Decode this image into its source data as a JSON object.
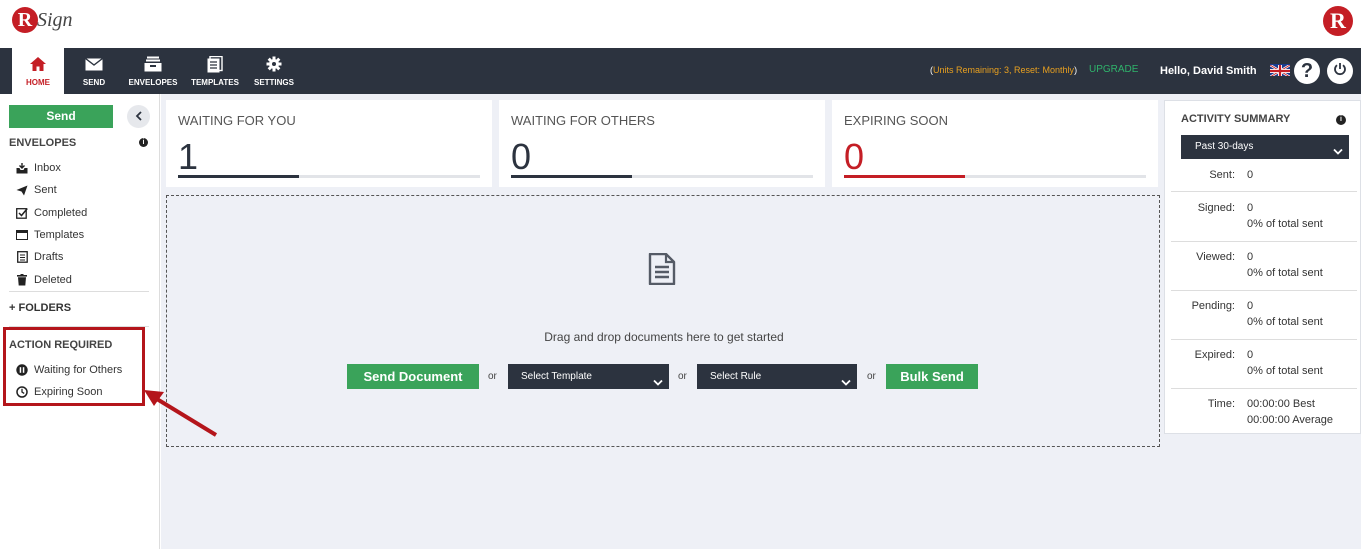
{
  "brand": {
    "initial": "R",
    "name": "Sign"
  },
  "nav": {
    "items": [
      {
        "id": "home",
        "label": "HOME"
      },
      {
        "id": "send",
        "label": "SEND"
      },
      {
        "id": "envelopes",
        "label": "ENVELOPES"
      },
      {
        "id": "templates",
        "label": "TEMPLATES"
      },
      {
        "id": "settings",
        "label": "SETTINGS"
      }
    ],
    "units_text": "Units Remaining: 3, Reset: Monthly",
    "upgrade_label": "UPGRADE",
    "greeting": "Hello, ",
    "user_name": "David Smith",
    "help_glyph": "?"
  },
  "sidebar": {
    "send_label": "Send",
    "envelopes_heading": "ENVELOPES",
    "items": [
      "Inbox",
      "Sent",
      "Completed",
      "Templates",
      "Drafts",
      "Deleted"
    ],
    "folders_label": "FOLDERS",
    "action_heading": "ACTION REQUIRED",
    "action_items": [
      "Waiting for Others",
      "Expiring Soon"
    ]
  },
  "stats": [
    {
      "label": "WAITING FOR YOU",
      "value": "1",
      "progress": 0.4
    },
    {
      "label": "WAITING FOR OTHERS",
      "value": "0",
      "progress": 0.4
    },
    {
      "label": "EXPIRING SOON",
      "value": "0",
      "progress": 0.4
    }
  ],
  "dropzone": {
    "prompt": "Drag and drop documents here to get started",
    "send_document": "Send Document",
    "or": "or",
    "select_template": "Select Template",
    "select_rule": "Select Rule",
    "bulk_send": "Bulk Send"
  },
  "activity": {
    "title": "ACTIVITY SUMMARY",
    "period": "Past 30-days",
    "metrics": [
      {
        "label": "Sent:",
        "value": "0",
        "sub": ""
      },
      {
        "label": "Signed:",
        "value": "0",
        "sub": "0% of total sent"
      },
      {
        "label": "Viewed:",
        "value": "0",
        "sub": "0% of total sent"
      },
      {
        "label": "Pending:",
        "value": "0",
        "sub": "0% of total sent"
      },
      {
        "label": "Expired:",
        "value": "0",
        "sub": "0% of total sent"
      },
      {
        "label": "Time:",
        "value": "00:00:00 Best",
        "sub": "00:00:00 Average"
      }
    ]
  },
  "colors": {
    "brand_red": "#c41e25",
    "nav_dark": "#2c333f",
    "green": "#3aa35a",
    "units_orange": "#e8a020"
  }
}
